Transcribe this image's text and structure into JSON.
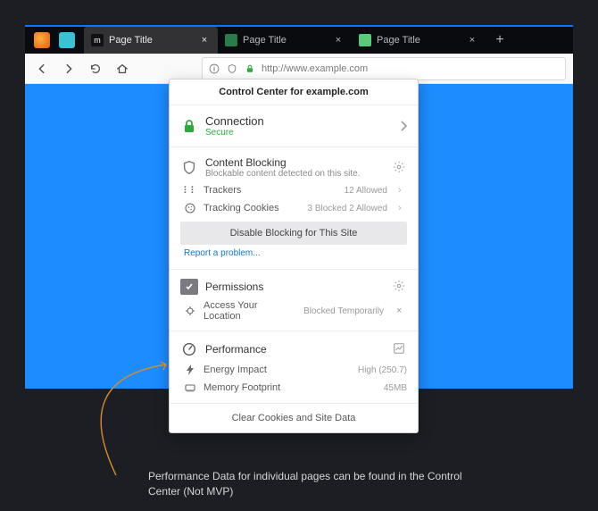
{
  "tabs": [
    {
      "title": "Page Title"
    },
    {
      "title": "Page Title"
    },
    {
      "title": "Page Title"
    }
  ],
  "url": "http://www.example.com",
  "panel_header": "Control Center for example.com",
  "connection": {
    "title": "Connection",
    "status": "Secure"
  },
  "content_blocking": {
    "title": "Content Blocking",
    "subtitle": "Blockable content detected on this site.",
    "trackers_label": "Trackers",
    "trackers_status": "12 Allowed",
    "cookies_label": "Tracking Cookies",
    "cookies_status": "3 Blocked 2 Allowed",
    "disable_button": "Disable Blocking for This Site",
    "report_link": "Report a problem..."
  },
  "permissions": {
    "title": "Permissions",
    "location_label": "Access Your Location",
    "location_status": "Blocked Temporarily"
  },
  "performance": {
    "title": "Performance",
    "energy_label": "Energy Impact",
    "energy_value": "High (250.7)",
    "memory_label": "Memory Footprint",
    "memory_value": "45MB"
  },
  "footer": "Clear Cookies and Site Data",
  "annotation": "Performance Data for individual pages can be found in the Control Center (Not MVP)"
}
